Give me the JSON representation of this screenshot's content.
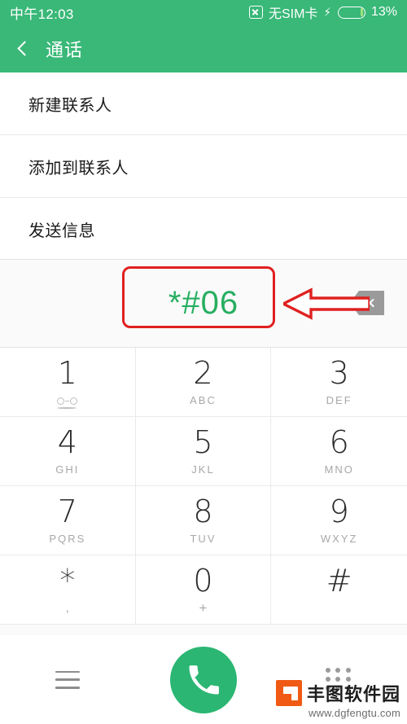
{
  "status_bar": {
    "time": "中午12:03",
    "sim_icon": "sim-card-disabled-icon",
    "sim_text": "无SIM卡",
    "charging_icon": "lightning-bolt-icon",
    "battery_icon": "battery-icon",
    "battery_percent": "13%",
    "battery_level": 13,
    "background_color": "#39b878"
  },
  "title_bar": {
    "back_icon": "chevron-left-icon",
    "title": "通话"
  },
  "option_list": {
    "items": [
      {
        "label": "新建联系人"
      },
      {
        "label": "添加到联系人"
      },
      {
        "label": "发送信息"
      }
    ]
  },
  "dialer": {
    "dialed_number": "*#06",
    "number_color": "#27ae60",
    "backspace_icon": "backspace-delete-icon",
    "keys": [
      {
        "digit": "1",
        "sub": "",
        "icon": "voicemail-icon"
      },
      {
        "digit": "2",
        "sub": "ABC",
        "icon": ""
      },
      {
        "digit": "3",
        "sub": "DEF",
        "icon": ""
      },
      {
        "digit": "4",
        "sub": "GHI",
        "icon": ""
      },
      {
        "digit": "5",
        "sub": "JKL",
        "icon": ""
      },
      {
        "digit": "6",
        "sub": "MNO",
        "icon": ""
      },
      {
        "digit": "7",
        "sub": "PQRS",
        "icon": ""
      },
      {
        "digit": "8",
        "sub": "TUV",
        "icon": ""
      },
      {
        "digit": "9",
        "sub": "WXYZ",
        "icon": ""
      },
      {
        "digit": "*",
        "sub": ",",
        "icon": ""
      },
      {
        "digit": "0",
        "sub": "+",
        "icon": ""
      },
      {
        "digit": "#",
        "sub": "",
        "icon": ""
      }
    ]
  },
  "bottom_bar": {
    "menu_icon": "hamburger-menu-icon",
    "call_icon": "phone-handset-icon",
    "call_button_color": "#2bb673",
    "keypad_icon": "dialpad-grid-icon"
  },
  "annotations": {
    "highlight_color": "#e02020",
    "box_target": "*#06",
    "arrow_target": "backspace-delete-icon"
  },
  "watermark": {
    "name": "丰图软件园",
    "url": "www.dgfengtu.com",
    "logo_color": "#f05a14"
  }
}
